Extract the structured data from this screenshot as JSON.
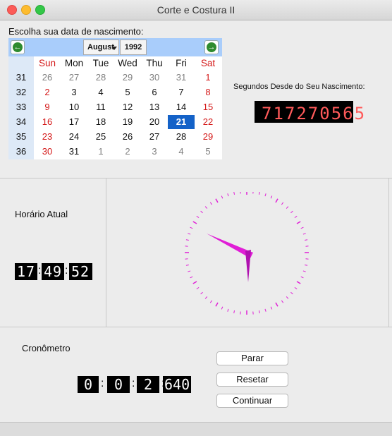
{
  "window": {
    "title": "Corte e Costura II"
  },
  "birth": {
    "label": "Escolha sua data de nascimento:",
    "month": "August",
    "year": "1992",
    "weekdays": [
      "Sun",
      "Mon",
      "Tue",
      "Wed",
      "Thu",
      "Fri",
      "Sat"
    ],
    "weeks": [
      {
        "wk": "31",
        "days": [
          "26",
          "27",
          "28",
          "29",
          "30",
          "31",
          "1"
        ]
      },
      {
        "wk": "32",
        "days": [
          "2",
          "3",
          "4",
          "5",
          "6",
          "7",
          "8"
        ]
      },
      {
        "wk": "33",
        "days": [
          "9",
          "10",
          "11",
          "12",
          "13",
          "14",
          "15"
        ]
      },
      {
        "wk": "34",
        "days": [
          "16",
          "17",
          "18",
          "19",
          "20",
          "21",
          "22"
        ]
      },
      {
        "wk": "35",
        "days": [
          "23",
          "24",
          "25",
          "26",
          "27",
          "28",
          "29"
        ]
      },
      {
        "wk": "36",
        "days": [
          "30",
          "31",
          "1",
          "2",
          "3",
          "4",
          "5"
        ]
      }
    ],
    "selected_day": "21"
  },
  "seconds": {
    "label": "Segundos Desde do Seu Nascimento:",
    "value": "717270565"
  },
  "clock": {
    "label": "Horário Atual",
    "hours": "17",
    "minutes": "49",
    "seconds": "52"
  },
  "stopwatch": {
    "label": "Cronômetro",
    "h": "0",
    "m": "0",
    "s": "2",
    "ms": "640",
    "buttons": {
      "stop": "Parar",
      "reset": "Resetar",
      "continue": "Continuar"
    }
  },
  "colors": {
    "accent": "#1462c8",
    "hand": "#e01ed6",
    "lcd_red": "#ff5a5a",
    "lcd_white": "#ffffff"
  }
}
